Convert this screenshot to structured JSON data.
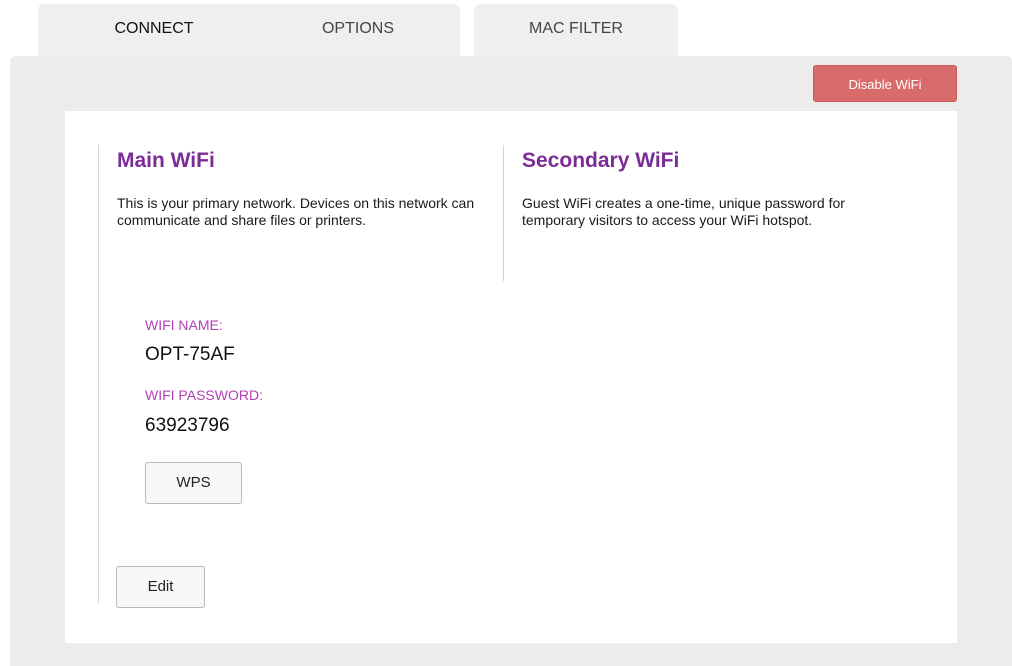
{
  "tabs": [
    {
      "label": "CONNECT",
      "active": true
    },
    {
      "label": "OPTIONS",
      "active": false
    },
    {
      "label": "MAC FILTER",
      "active": false
    }
  ],
  "toolbar": {
    "disable_wifi_label": "Disable WiFi"
  },
  "main_wifi": {
    "title": "Main WiFi",
    "description": "This is your primary network. Devices on this network can communicate and share files or printers.",
    "name_label": "WIFI NAME:",
    "name_value": "OPT-75AF",
    "password_label": "WIFI PASSWORD:",
    "password_value": "63923796",
    "wps_label": "WPS",
    "edit_label": "Edit"
  },
  "secondary_wifi": {
    "title": "Secondary WiFi",
    "description": "Guest WiFi creates a one-time, unique password for temporary visitors to access your WiFi hotspot."
  },
  "colors": {
    "title_purple": "#7b2c95",
    "label_magenta": "#b13fb6",
    "disable_button_red": "#d96b6b",
    "panel_gray": "#ececec"
  }
}
